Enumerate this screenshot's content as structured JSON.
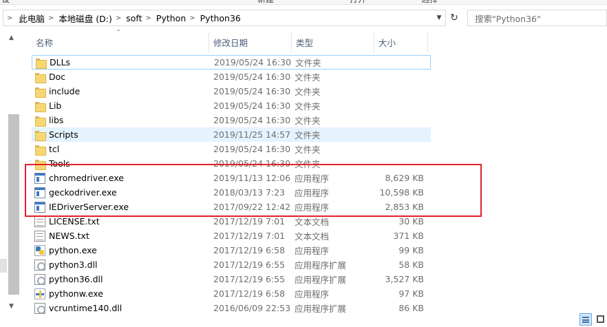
{
  "ribbon": {
    "labels": [
      "设",
      "新建",
      "打开",
      "选择"
    ]
  },
  "address": {
    "crumbs": [
      "此电脑",
      "本地磁盘 (D:)",
      "soft",
      "Python",
      "Python36"
    ],
    "search_placeholder": "搜索\"Python36\""
  },
  "columns": {
    "name": "名称",
    "date": "修改日期",
    "type": "类型",
    "size": "大小"
  },
  "files": [
    {
      "name": "DLLs",
      "date": "2019/05/24 16:30",
      "type": "文件夹",
      "size": "",
      "icon": "folder-icon"
    },
    {
      "name": "Doc",
      "date": "2019/05/24 16:30",
      "type": "文件夹",
      "size": "",
      "icon": "folder-icon"
    },
    {
      "name": "include",
      "date": "2019/05/24 16:30",
      "type": "文件夹",
      "size": "",
      "icon": "folder-icon"
    },
    {
      "name": "Lib",
      "date": "2019/05/24 16:30",
      "type": "文件夹",
      "size": "",
      "icon": "folder-icon"
    },
    {
      "name": "libs",
      "date": "2019/05/24 16:30",
      "type": "文件夹",
      "size": "",
      "icon": "folder-icon"
    },
    {
      "name": "Scripts",
      "date": "2019/11/25 14:57",
      "type": "文件夹",
      "size": "",
      "icon": "folder-icon"
    },
    {
      "name": "tcl",
      "date": "2019/05/24 16:30",
      "type": "文件夹",
      "size": "",
      "icon": "folder-icon"
    },
    {
      "name": "Tools",
      "date": "2019/05/24 16:30",
      "type": "文件夹",
      "size": "",
      "icon": "folder-icon"
    },
    {
      "name": "chromedriver.exe",
      "date": "2019/11/13 12:06",
      "type": "应用程序",
      "size": "8,629 KB",
      "icon": "exe-icon"
    },
    {
      "name": "geckodriver.exe",
      "date": "2018/03/13 7:23",
      "type": "应用程序",
      "size": "10,598 KB",
      "icon": "exe-icon"
    },
    {
      "name": "IEDriverServer.exe",
      "date": "2017/09/22 12:42",
      "type": "应用程序",
      "size": "2,853 KB",
      "icon": "exe-icon"
    },
    {
      "name": "LICENSE.txt",
      "date": "2017/12/19 7:01",
      "type": "文本文档",
      "size": "30 KB",
      "icon": "txt-icon"
    },
    {
      "name": "NEWS.txt",
      "date": "2017/12/19 7:01",
      "type": "文本文档",
      "size": "371 KB",
      "icon": "txt-icon"
    },
    {
      "name": "python.exe",
      "date": "2017/12/19 6:58",
      "type": "应用程序",
      "size": "99 KB",
      "icon": "python-icon"
    },
    {
      "name": "python3.dll",
      "date": "2017/12/19 6:55",
      "type": "应用程序扩展",
      "size": "58 KB",
      "icon": "dll-icon"
    },
    {
      "name": "python36.dll",
      "date": "2017/12/19 6:55",
      "type": "应用程序扩展",
      "size": "3,527 KB",
      "icon": "dll-icon"
    },
    {
      "name": "pythonw.exe",
      "date": "2017/12/19 6:58",
      "type": "应用程序",
      "size": "97 KB",
      "icon": "pythonw-icon"
    },
    {
      "name": "vcruntime140.dll",
      "date": "2016/06/09 22:53",
      "type": "应用程序扩展",
      "size": "86 KB",
      "icon": "dll-icon"
    }
  ],
  "state": {
    "focused_row": 0,
    "hover_row": 5
  },
  "colors": {
    "highlight_box": "#e0202a",
    "hover": "#e5f3ff",
    "focus_border": "#99d1ff"
  }
}
